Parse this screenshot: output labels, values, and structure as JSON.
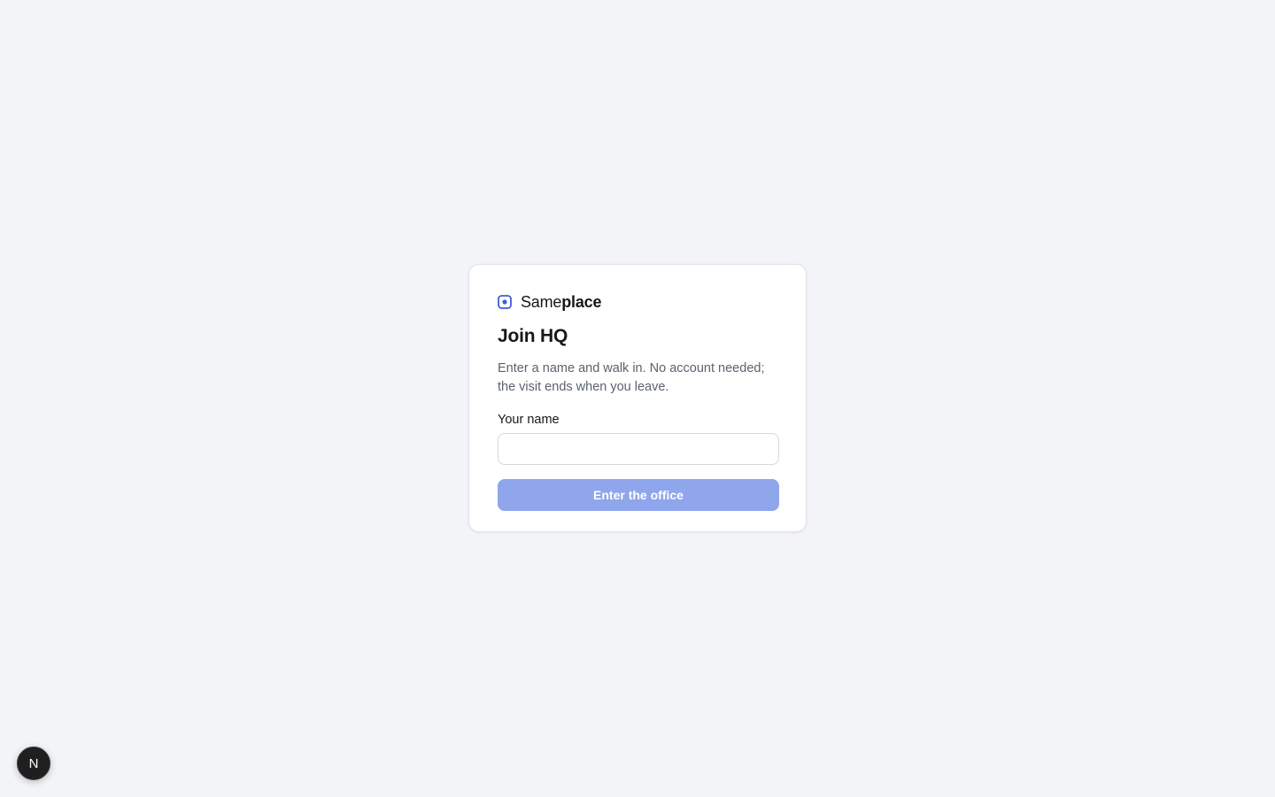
{
  "brand": {
    "icon": "target-square-icon",
    "name_light": "Same",
    "name_bold": "place",
    "accent_color": "#3f5fd6"
  },
  "join": {
    "title": "Join HQ",
    "description": "Enter a name and walk in. No account needed; the visit ends when you leave.",
    "name_label": "Your name",
    "name_value": "",
    "name_placeholder": "",
    "submit_label": "Enter the office",
    "submit_color": "#8fa6ec"
  },
  "dev_badge": {
    "icon": "nextjs-logo-icon",
    "letter": "N"
  }
}
